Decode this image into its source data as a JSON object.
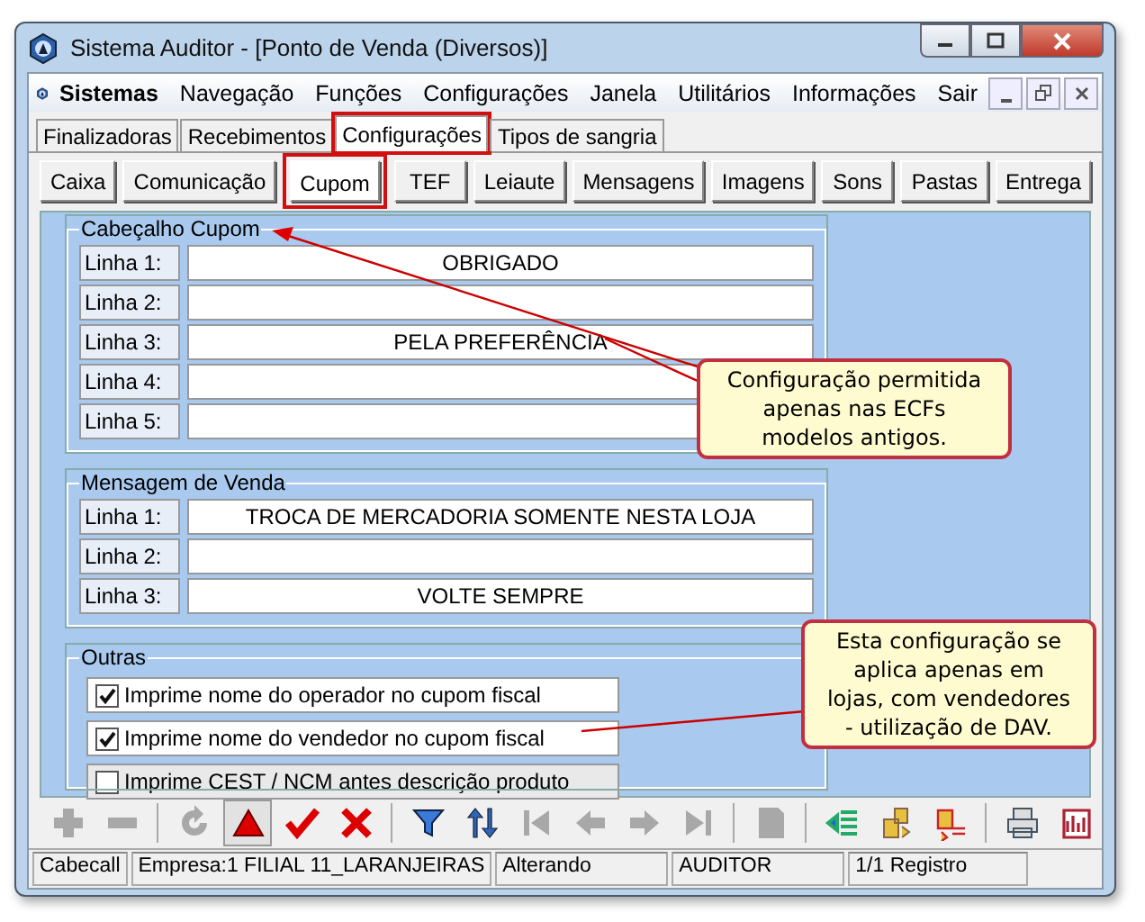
{
  "window": {
    "title": "Sistema Auditor - [Ponto de Venda (Diversos)]"
  },
  "menu": {
    "brand": "Sistemas",
    "items": [
      "Navegação",
      "Funções",
      "Configurações",
      "Janela",
      "Utilitários",
      "Informações",
      "Sair"
    ]
  },
  "tabs": [
    {
      "label": "Finalizadoras",
      "selected": false
    },
    {
      "label": "Recebimentos",
      "selected": false
    },
    {
      "label": "Configurações",
      "selected": true
    },
    {
      "label": "Tipos de sangria",
      "selected": false
    }
  ],
  "subtabs": [
    {
      "label": "Caixa",
      "selected": false
    },
    {
      "label": "Comunicação",
      "selected": false
    },
    {
      "label": "Cupom",
      "selected": true
    },
    {
      "label": "TEF",
      "selected": false
    },
    {
      "label": "Leiaute",
      "selected": false
    },
    {
      "label": "Mensagens",
      "selected": false
    },
    {
      "label": "Imagens",
      "selected": false
    },
    {
      "label": "Sons",
      "selected": false
    },
    {
      "label": "Pastas",
      "selected": false
    },
    {
      "label": "Entrega",
      "selected": false
    }
  ],
  "header_group": {
    "title": "Cabeçalho Cupom",
    "lines": [
      {
        "label": "Linha 1:",
        "value": "OBRIGADO"
      },
      {
        "label": "Linha 2:"
      },
      {
        "label": "Linha 3:",
        "value": "PELA PREFERÊNCIA"
      },
      {
        "label": "Linha 4:"
      },
      {
        "label": "Linha 5:"
      }
    ]
  },
  "sale_group": {
    "title": "Mensagem de Venda",
    "lines": [
      {
        "label": "Linha 1:",
        "value": "TROCA DE MERCADORIA SOMENTE NESTA LOJA"
      },
      {
        "label": "Linha 2:"
      },
      {
        "label": "Linha 3:",
        "value": "VOLTE SEMPRE"
      }
    ]
  },
  "other_group": {
    "title": "Outras",
    "options": [
      {
        "label": "Imprime nome do operador no cupom fiscal",
        "checked": true
      },
      {
        "label": "Imprime nome do vendedor no cupom fiscal",
        "checked": true
      },
      {
        "label": "Imprime CEST / NCM antes descrição produto",
        "checked": false
      }
    ]
  },
  "callouts": [
    "Configuração permitida apenas nas ECFs modelos antigos.",
    "Esta configuração se aplica apenas em lojas, com vendedores - utilização de DAV."
  ],
  "toolbar": [
    {
      "kind": "plus",
      "disabled": true
    },
    {
      "kind": "minus",
      "disabled": true
    },
    {
      "kind": "sep"
    },
    {
      "kind": "refresh",
      "disabled": true
    },
    {
      "kind": "triangle",
      "disabled": false,
      "selected": true
    },
    {
      "kind": "check",
      "disabled": false
    },
    {
      "kind": "cross",
      "disabled": false
    },
    {
      "kind": "sep"
    },
    {
      "kind": "funnel",
      "disabled": false
    },
    {
      "kind": "sort",
      "disabled": false
    },
    {
      "kind": "first",
      "disabled": true
    },
    {
      "kind": "prev",
      "disabled": true
    },
    {
      "kind": "next",
      "disabled": true
    },
    {
      "kind": "last",
      "disabled": true
    },
    {
      "kind": "sep"
    },
    {
      "kind": "doc",
      "disabled": true
    },
    {
      "kind": "sep"
    },
    {
      "kind": "list",
      "disabled": false
    },
    {
      "kind": "swap",
      "disabled": false
    },
    {
      "kind": "dblist",
      "disabled": false
    },
    {
      "kind": "sep"
    },
    {
      "kind": "print",
      "disabled": false
    },
    {
      "kind": "chart",
      "disabled": false
    }
  ],
  "status_bar": [
    "Cabecall",
    "Empresa:1 FILIAL 11_LARANJEIRAS",
    "Alterando",
    "AUDITOR",
    "1/1 Registro"
  ]
}
